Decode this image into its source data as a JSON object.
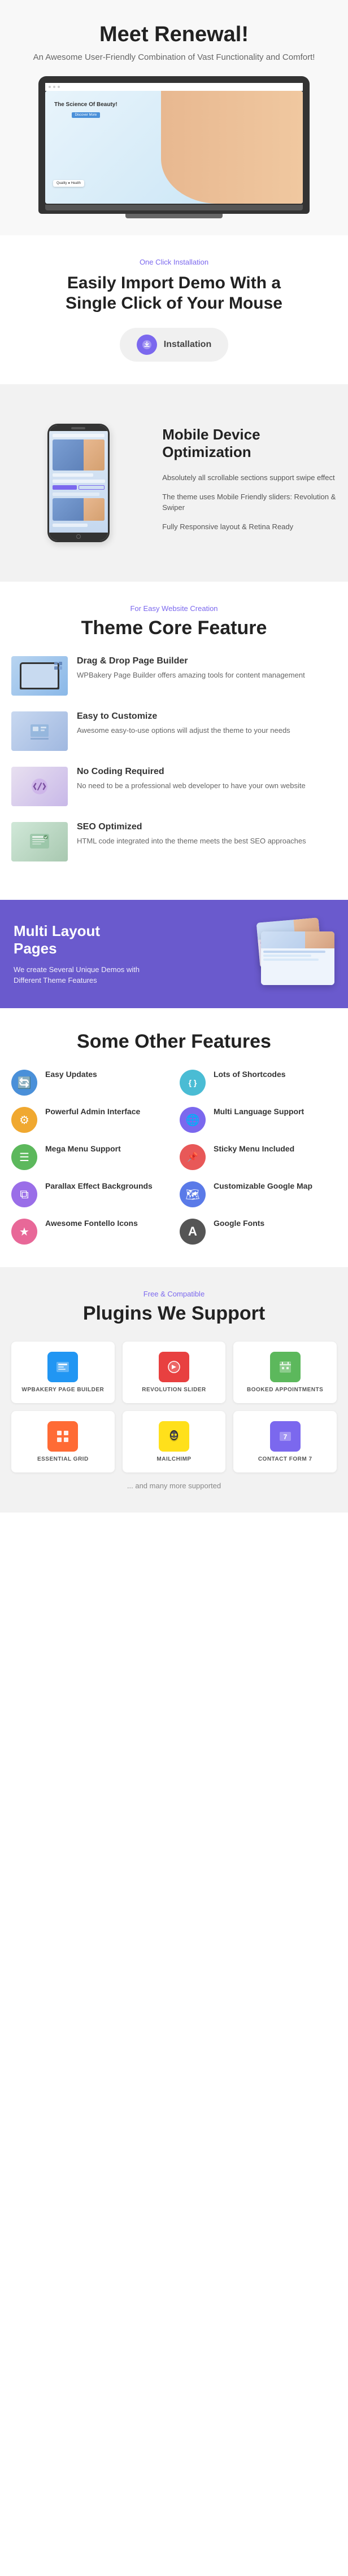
{
  "hero": {
    "title": "Meet Renewal!",
    "subtitle": "An Awesome User-Friendly Combination of Vast Functionality and Comfort!",
    "laptop_screen": {
      "title": "The Science Of Beauty!",
      "button": "Discover More"
    }
  },
  "install": {
    "tag": "One Click Installation",
    "heading_line1": "Easily Import Demo With a",
    "heading_line2": "Single Click of Your Mouse",
    "button_label": "Installation"
  },
  "mobile": {
    "heading_line1": "Mobile Device",
    "heading_line2": "Optimization",
    "features": [
      {
        "text": "Absolutely all scrollable sections support swipe effect"
      },
      {
        "text": "The theme uses Mobile Friendly sliders: Revolution & Swiper"
      },
      {
        "text": "Fully Responsive layout & Retina Ready"
      }
    ]
  },
  "core": {
    "tag": "For Easy Website Creation",
    "heading": "Theme Core Feature",
    "features": [
      {
        "name": "Drag & Drop Page  Builder",
        "desc": "WPBakery Page Builder offers amazing tools for content management"
      },
      {
        "name": "Easy to Customize",
        "desc": "Awesome easy-to-use options will adjust the theme to your needs"
      },
      {
        "name": "No Coding Required",
        "desc": "No need to be a professional web developer to have your own website"
      },
      {
        "name": "SEO Optimized",
        "desc": "HTML code integrated into the theme meets the best SEO approaches"
      }
    ]
  },
  "multi": {
    "heading_line1": "Multi Layout",
    "heading_line2": "Pages",
    "desc": "We create Several Unique Demos with Different Theme Features"
  },
  "other": {
    "heading": "Some Other Features",
    "features": [
      {
        "label": "Easy Updates",
        "icon": "🔄",
        "color": "blue"
      },
      {
        "label": "Lots of Shortcodes",
        "icon": "{ }",
        "color": "teal"
      },
      {
        "label": "Powerful Admin Interface",
        "icon": "⚙",
        "color": "orange"
      },
      {
        "label": "Multi Language Support",
        "icon": "🌐",
        "color": "purple"
      },
      {
        "label": "Mega Menu Support",
        "icon": "☰",
        "color": "green"
      },
      {
        "label": "Sticky Menu Included",
        "icon": "📌",
        "color": "red"
      },
      {
        "label": "Parallax Effect Backgrounds",
        "icon": "⧉",
        "color": "violet"
      },
      {
        "label": "Customizable Google Map",
        "icon": "🗺",
        "color": "indigo"
      },
      {
        "label": "Awesome Fontello Icons",
        "icon": "★",
        "color": "pink"
      },
      {
        "label": "Google Fonts",
        "icon": "A",
        "color": "dark"
      }
    ]
  },
  "plugins": {
    "tag": "Free & Compatible",
    "heading": "Plugins We Support",
    "items": [
      {
        "name": "WPBAKERY PAGE BUILDER",
        "icon": "W",
        "color": "wp"
      },
      {
        "name": "REVOLUTION SLIDER",
        "icon": "R",
        "color": "rev"
      },
      {
        "name": "BOOKED APPOINTMENTS",
        "icon": "📅",
        "color": "book"
      },
      {
        "name": "ESSENTIAL GRID",
        "icon": "⊞",
        "color": "grid"
      },
      {
        "name": "MAILCHIMP",
        "icon": "✉",
        "color": "mail"
      },
      {
        "name": "CONTACT FORM 7",
        "icon": "7",
        "color": "contact"
      }
    ],
    "more_text": "... and many more supported"
  }
}
